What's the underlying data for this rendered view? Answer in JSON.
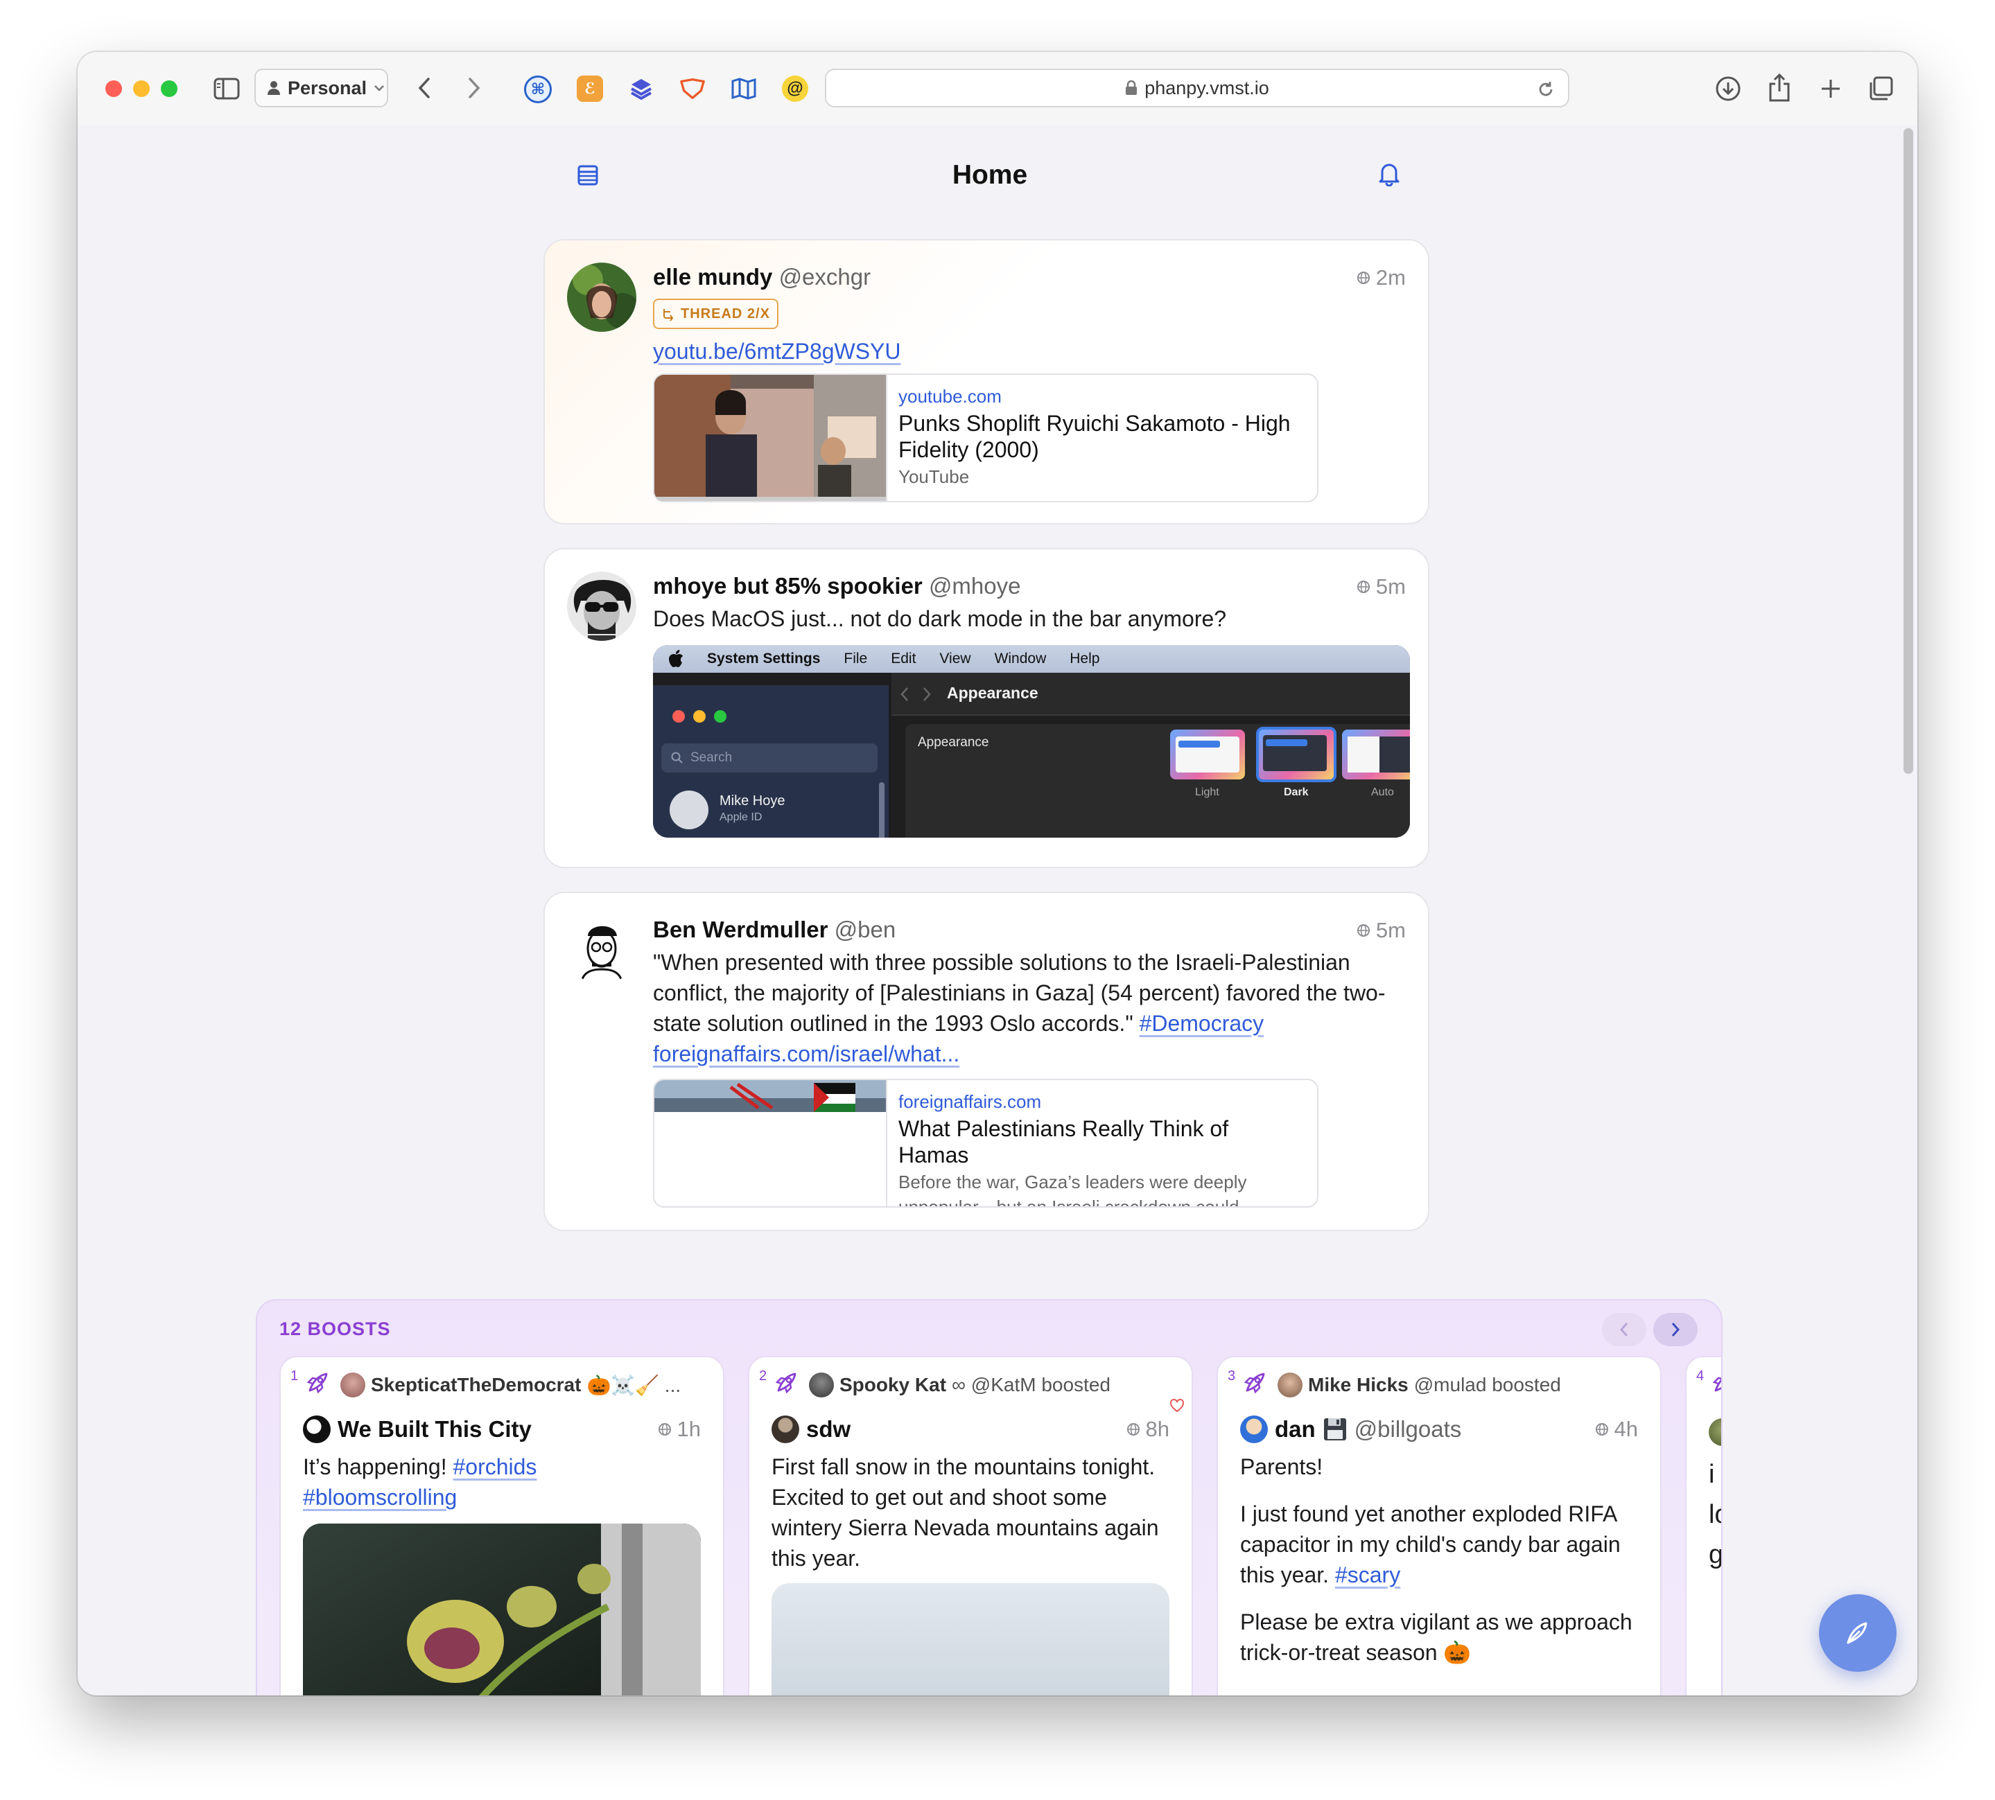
{
  "browser": {
    "profile_label": "Personal",
    "url": "phanpy.vmst.io",
    "extensions": [
      "command-extension",
      "e-extension",
      "layers-extension",
      "shield-extension",
      "map-extension",
      "at-extension"
    ]
  },
  "header": {
    "title": "Home"
  },
  "posts": [
    {
      "name": "elle mundy",
      "handle": "@exchgr",
      "time": "2m",
      "badge": "THREAD 2/X",
      "link_text": "youtu.be/6mtZP8gWSYU",
      "preview": {
        "domain": "youtube.com",
        "title": "Punks Shoplift Ryuichi Sakamoto - High Fidelity (2000)",
        "sub": "YouTube"
      }
    },
    {
      "name": "mhoye but 85% spookier",
      "handle": "@mhoye",
      "time": "5m",
      "text": "Does MacOS just... not do dark mode in the bar anymore?",
      "screenshot": {
        "menu": [
          "System Settings",
          "File",
          "Edit",
          "View",
          "Window",
          "Help"
        ],
        "search": "Search",
        "user": "Mike Hoye",
        "user_sub": "Apple ID",
        "pane_title": "Appearance",
        "setting_label": "Appearance",
        "options": [
          "Light",
          "Dark",
          "Auto"
        ]
      }
    },
    {
      "name": "Ben Werdmuller",
      "handle": "@ben",
      "time": "5m",
      "text": "\"When presented with three possible solutions to the Israeli-Palestinian conflict, the majority of [Palestinians in Gaza] (54 percent) favored the two-state solution outlined in the 1993 Oslo accords.\" ",
      "hashtag": "#Democracy",
      "link_text": "foreignaffairs.com/israel/what...",
      "preview": {
        "domain": "foreignaffairs.com",
        "title": "What Palestinians Really Think of Hamas",
        "sub": "Before the war, Gaza’s leaders were deeply unpopular—but an Israeli crackdown could..."
      }
    }
  ],
  "boosts": {
    "title": "12 BOOSTS",
    "cards": [
      {
        "num": "1",
        "booster": "SkepticatTheDemocrat",
        "booster_suffix": "🎃☠️🧹 ...",
        "author": "We Built This City",
        "time": "1h",
        "text": "It’s happening! ",
        "tags": [
          "#orchids",
          "#bloomscrolling"
        ]
      },
      {
        "num": "2",
        "booster": "Spooky Kat",
        "booster_suffix": "∞ @KatM boosted",
        "author": "sdw",
        "time": "8h",
        "text": "First fall snow in the mountains tonight. Excited to get out and shoot some wintery Sierra Nevada mountains again this year."
      },
      {
        "num": "3",
        "booster": "Mike Hicks",
        "booster_suffix": "@mulad boosted",
        "author": "dan",
        "author_handle": "@billgoats",
        "time": "4h",
        "para1": "Parents!",
        "para2": "I just found yet another exploded RIFA capacitor in my child's candy bar again this year. ",
        "para2_tag": "#scary",
        "para3": "Please be extra vigilant as we approach trick-or-treat season 🎃"
      },
      {
        "num": "4",
        "text_partial": [
          "i a",
          "lo",
          "gi"
        ]
      }
    ]
  },
  "colors": {
    "accent": "#2f5bd8",
    "boost_purple": "#8a3fd1",
    "thread_orange": "#c77a1a",
    "fab": "#6d8fe6"
  }
}
